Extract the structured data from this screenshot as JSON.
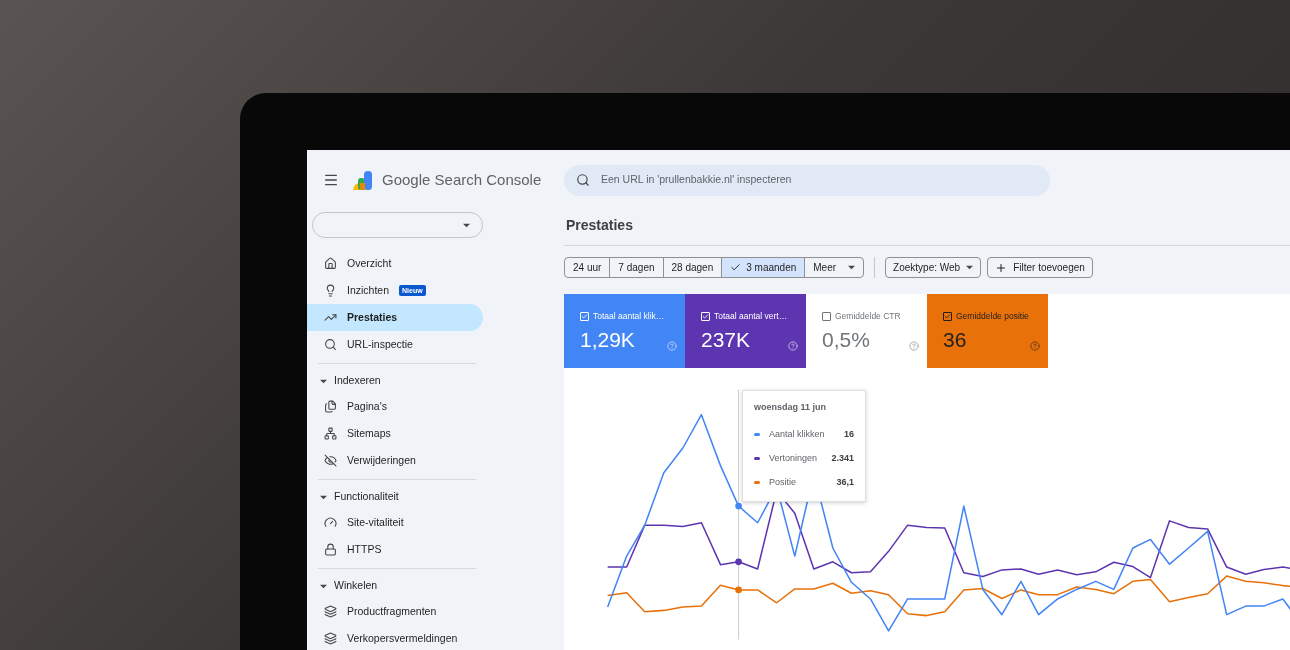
{
  "header": {
    "product_name": "Google Search Console",
    "search": {
      "placeholder": "Een URL in 'prullenbakkie.nl' inspecteren"
    }
  },
  "sidebar": {
    "items": [
      {
        "label": "Overzicht",
        "selected": false
      },
      {
        "label": "Inzichten",
        "selected": false,
        "badge": "Nieuw"
      },
      {
        "label": "Prestaties",
        "selected": true
      },
      {
        "label": "URL-inspectie",
        "selected": false
      }
    ],
    "sections": [
      {
        "label": "Indexeren",
        "expanded": true,
        "items": [
          {
            "label": "Pagina's",
            "selected": false
          },
          {
            "label": "Sitemaps",
            "selected": false
          },
          {
            "label": "Verwijderingen",
            "selected": false
          }
        ]
      },
      {
        "label": "Functionaliteit",
        "expanded": true,
        "items": [
          {
            "label": "Site-vitaliteit",
            "selected": false
          },
          {
            "label": "HTTPS",
            "selected": false
          }
        ]
      },
      {
        "label": "Winkelen",
        "expanded": true,
        "items": [
          {
            "label": "Productfragmenten",
            "selected": false
          },
          {
            "label": "Verkopersvermeldingen",
            "selected": false
          }
        ]
      }
    ]
  },
  "page": {
    "title": "Prestaties",
    "date_ranges": [
      {
        "label": "24 uur",
        "selected": false
      },
      {
        "label": "7 dagen",
        "selected": false
      },
      {
        "label": "28 dagen",
        "selected": false
      },
      {
        "label": "3 maanden",
        "selected": true
      }
    ],
    "more_menu": {
      "label": "Meer"
    },
    "filters": [
      {
        "label": "Zoektype: Web",
        "kind": "dropdown"
      },
      {
        "label": "Filter toevoegen",
        "kind": "add"
      }
    ],
    "metrics": [
      {
        "label": "Totaal aantal klik…",
        "value": "1,29K",
        "checked": true,
        "color": "#4285f4"
      },
      {
        "label": "Totaal aantal vert…",
        "value": "237K",
        "checked": true,
        "color": "#5e35b1"
      },
      {
        "label": "Gemiddelde CTR",
        "value": "0,5%",
        "checked": false
      },
      {
        "label": "Gemiddelde positie",
        "value": "36",
        "checked": true,
        "color": "#e8710a"
      }
    ],
    "tooltip": {
      "date": "woensdag 11 jun",
      "rows": [
        {
          "label": "Aantal klikken",
          "value": "16",
          "color": "#4285f4"
        },
        {
          "label": "Vertoningen",
          "value": "2.341",
          "color": "#5e35b1"
        },
        {
          "label": "Positie",
          "value": "36,1",
          "color": "#e8710a"
        }
      ]
    }
  }
}
